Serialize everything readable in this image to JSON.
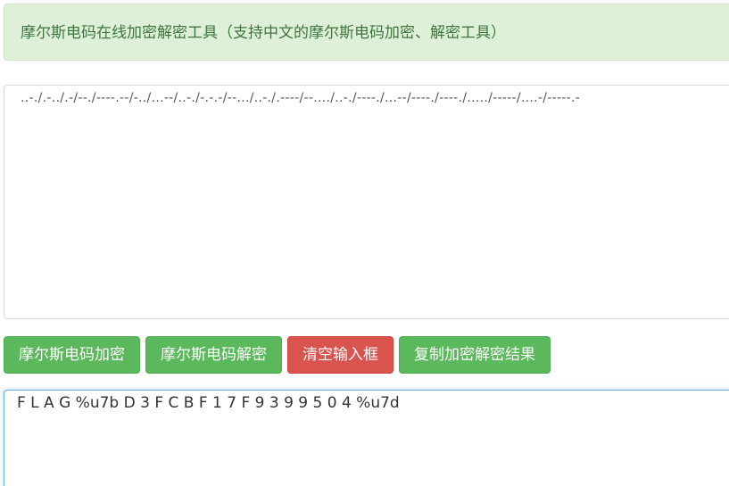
{
  "banner": {
    "text": "摩尔斯电码在线加密解密工具（支持中文的摩尔斯电码加密、解密工具）"
  },
  "input": {
    "value": "..-./.-../.-/--./----.--/-../...--/..-./-.-.-/--.../..-./.----/--..../..-./----./...--/----./----./...../-----/....-/-----.-"
  },
  "buttons": {
    "encrypt": "摩尔斯电码加密",
    "decrypt": "摩尔斯电码解密",
    "clear": "清空输入框",
    "copy": "复制加密解密结果"
  },
  "output": {
    "value": "F L A G %u7b D 3 F C B F 1 7 F 9 3 9 9 5 0 4 %u7d"
  },
  "colors": {
    "banner_bg": "#dff0d8",
    "banner_text": "#3c763d",
    "button_green": "#5cb85c",
    "button_red": "#d9534f",
    "focus_border": "#66afe9"
  }
}
